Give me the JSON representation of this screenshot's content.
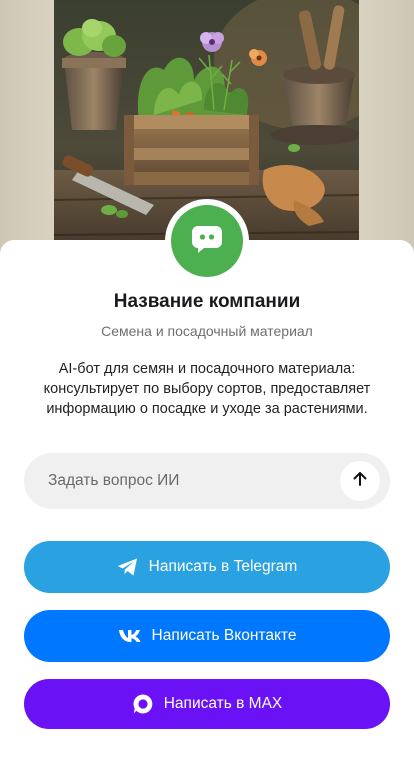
{
  "hero": {
    "image": "garden-crate-photo"
  },
  "company": {
    "avatar_icon": "chat-bot-icon",
    "name": "Название компании",
    "subtitle": "Семена и посадочный материал",
    "description": "AI-бот для семян и посадочного материала: консультирует по выбору сортов, предоставляет информацию о посадке и уходе за растениями."
  },
  "ask": {
    "placeholder": "Задать вопрос ИИ",
    "value": "",
    "send_icon": "arrow-up-icon"
  },
  "actions": {
    "telegram": {
      "label": "Написать в Telegram",
      "icon": "telegram-icon",
      "color": "#2aa1e0"
    },
    "vk": {
      "label": "Написать Вконтакте",
      "icon": "vk-icon",
      "color": "#0077ff"
    },
    "max": {
      "label": "Написать в MAX",
      "icon": "max-icon",
      "color": "#6a11f5"
    }
  },
  "colors": {
    "avatar": "#4caf50",
    "card": "#ffffff",
    "input_bg": "#f0f0f0"
  }
}
